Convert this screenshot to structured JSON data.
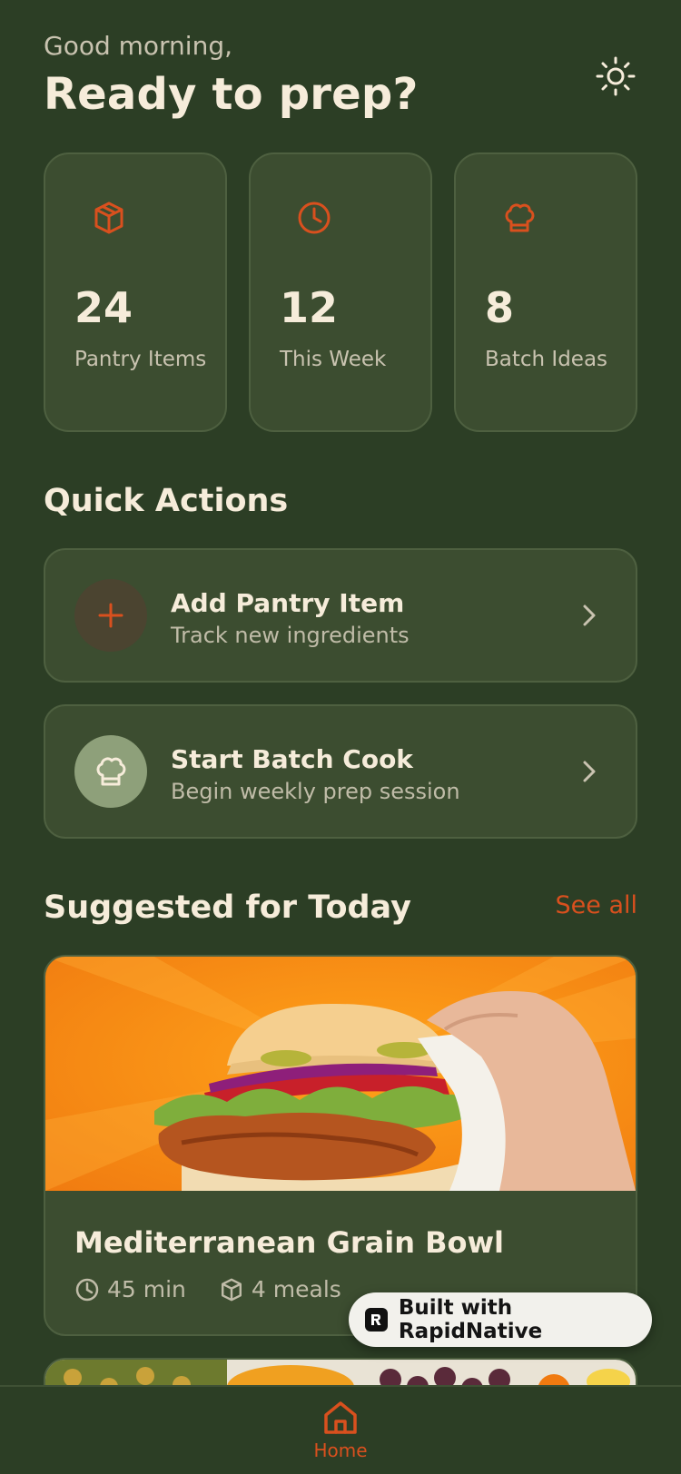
{
  "header": {
    "greeting": "Good morning,",
    "title": "Ready to prep?",
    "theme_toggle_icon": "sun-icon"
  },
  "stats": [
    {
      "icon": "package-icon",
      "value": "24",
      "label": "Pantry Items"
    },
    {
      "icon": "clock-icon",
      "value": "12",
      "label": "This Week"
    },
    {
      "icon": "chef-hat-icon",
      "value": "8",
      "label": "Batch Ideas"
    }
  ],
  "quick_actions": {
    "title": "Quick Actions",
    "items": [
      {
        "icon": "plus-icon",
        "title": "Add Pantry Item",
        "subtitle": "Track new ingredients"
      },
      {
        "icon": "chef-hat-icon",
        "title": "Start Batch Cook",
        "subtitle": "Begin weekly prep session"
      }
    ]
  },
  "suggested": {
    "title": "Suggested for Today",
    "see_all": "See all",
    "recipes": [
      {
        "title": "Mediterranean Grain Bowl",
        "time": "45 min",
        "meals": "4 meals"
      }
    ]
  },
  "badge": {
    "text": "Built with RapidNative"
  },
  "tabbar": {
    "home_label": "Home"
  },
  "colors": {
    "background": "#2c3e25",
    "card": "#3c4d30",
    "accent": "#d9501e",
    "text": "#f6ecda"
  }
}
